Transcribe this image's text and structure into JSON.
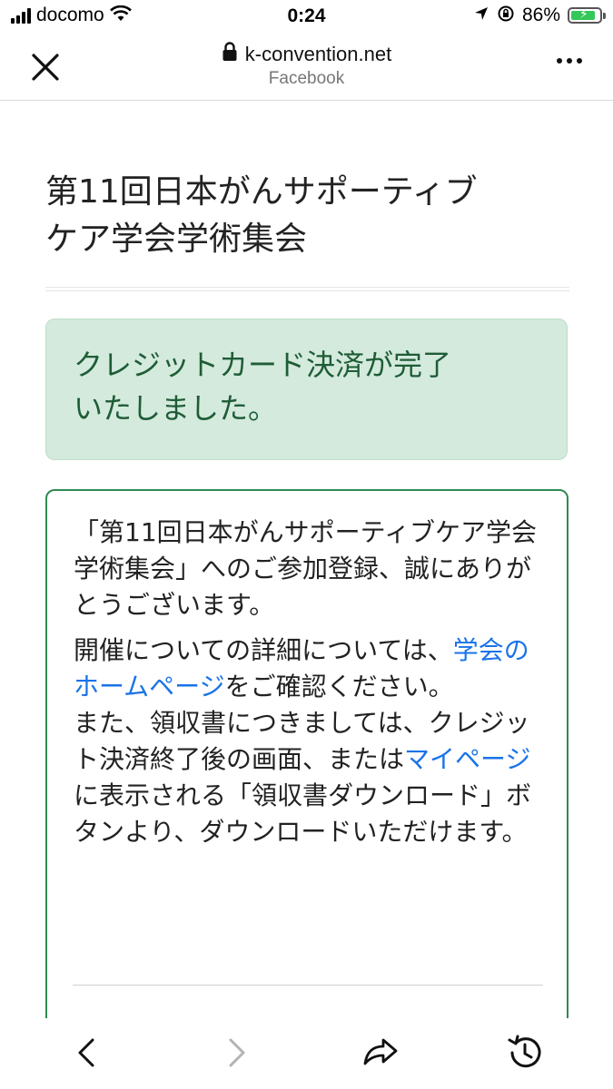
{
  "status_bar": {
    "carrier": "docomo",
    "time": "0:24",
    "battery_percent": "86%",
    "battery_level": 0.86,
    "charging": true,
    "icons": [
      "signal-icon",
      "wifi-icon",
      "location-icon",
      "orientation-lock-icon",
      "battery-icon"
    ]
  },
  "browser": {
    "url": "k-convention.net",
    "subtitle": "Facebook",
    "icons": [
      "close-icon",
      "lock-icon",
      "more-icon"
    ]
  },
  "page": {
    "title_lines": [
      "第11回日本がんサポーティブ",
      "ケア学会学術集会"
    ],
    "alert_lines": [
      "クレジットカード決済が完了",
      "いたしました。"
    ],
    "card": {
      "thanks": "「第11回日本がんサポーティブケア学会学術集会」へのご参加登録、誠にありがとうございます。",
      "details_before": "開催についての詳細については、",
      "homepage_link": "学会のホームページ",
      "details_after": "をご確認ください。",
      "receipt_before": "また、領収書につきましては、クレジット決済終了後の画面、または",
      "mypage_link": "マイページ",
      "receipt_after": "に表示される「領収書ダウンロード」ボタンより、ダウンロードいただけます。"
    }
  },
  "toolbar": {
    "icons": [
      "back-icon",
      "forward-icon",
      "share-icon",
      "history-icon"
    ]
  },
  "colors": {
    "alert_bg": "#d4eadd",
    "alert_text": "#1e5c36",
    "card_border": "#2f8a52",
    "link": "#1a73e8",
    "battery_green": "#34c759"
  }
}
